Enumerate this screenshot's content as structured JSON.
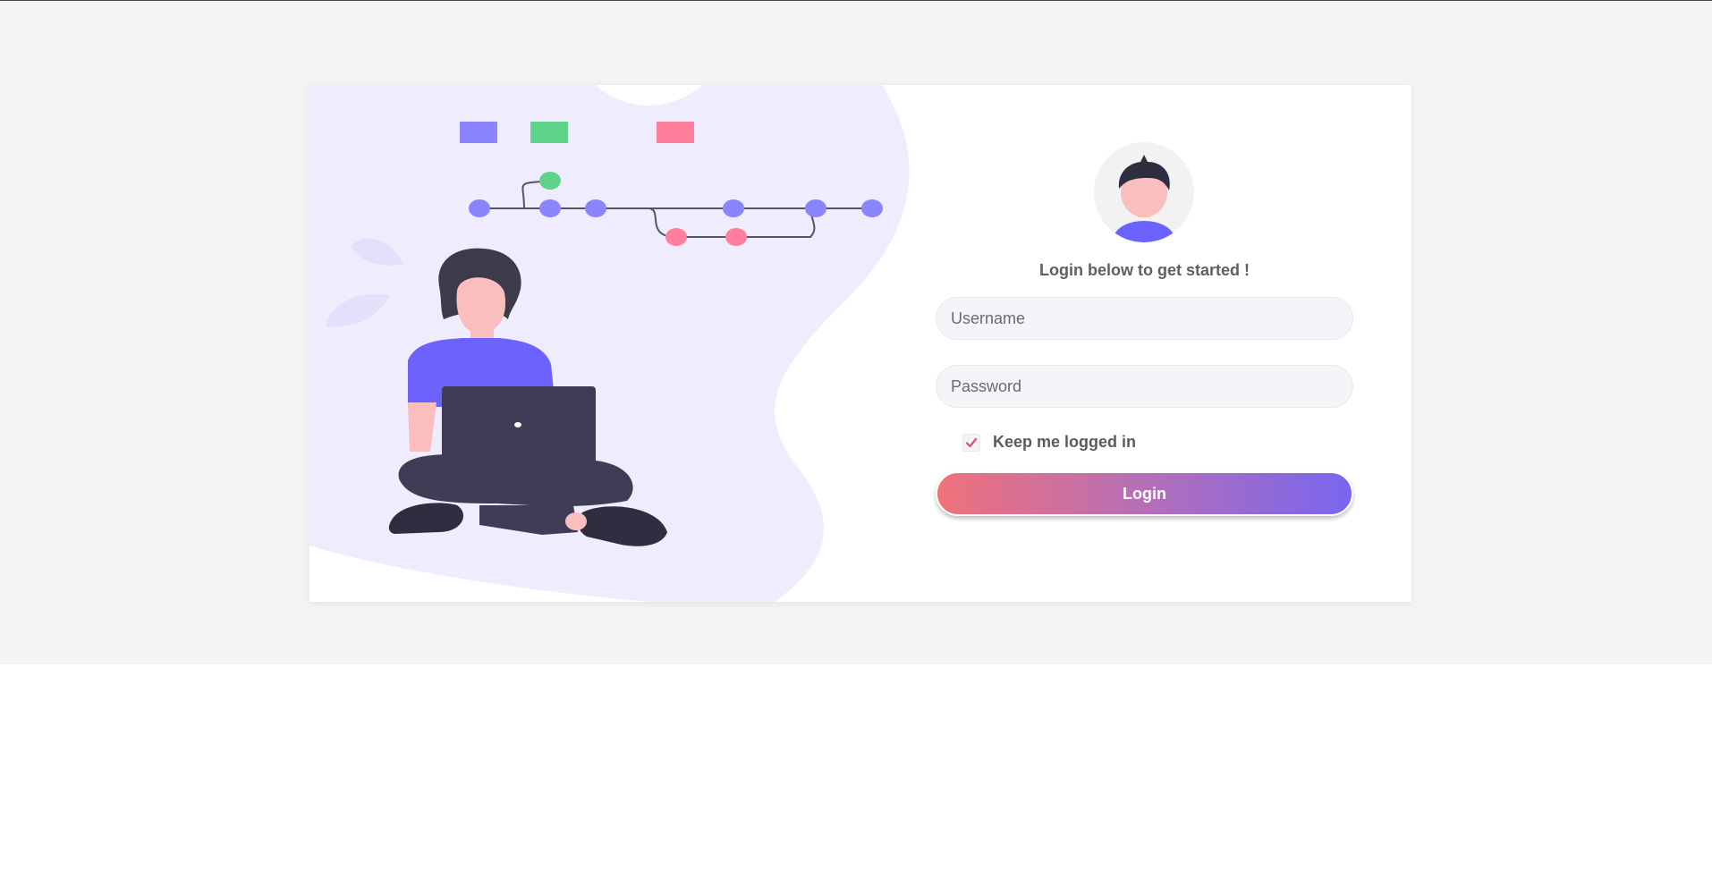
{
  "form": {
    "heading": "Login below to get started !",
    "username_placeholder": "Username",
    "password_placeholder": "Password",
    "remember_label": "Keep me logged in",
    "remember_checked": true,
    "login_label": "Login"
  },
  "colors": {
    "page_background": "#f4f4f4",
    "card_background": "#ffffff",
    "illustration_blob": "#eeecfd",
    "accent_purple": "#8a84ff",
    "accent_green": "#5ed389",
    "accent_pink": "#ff7f9c",
    "button_gradient_start": "#f0717a",
    "button_gradient_end": "#7866ef",
    "check_color": "#e84a5f"
  },
  "icons": {
    "avatar": "user-avatar-icon",
    "checkbox": "checkmark-icon",
    "illustration": "person-with-laptop-illustration"
  }
}
